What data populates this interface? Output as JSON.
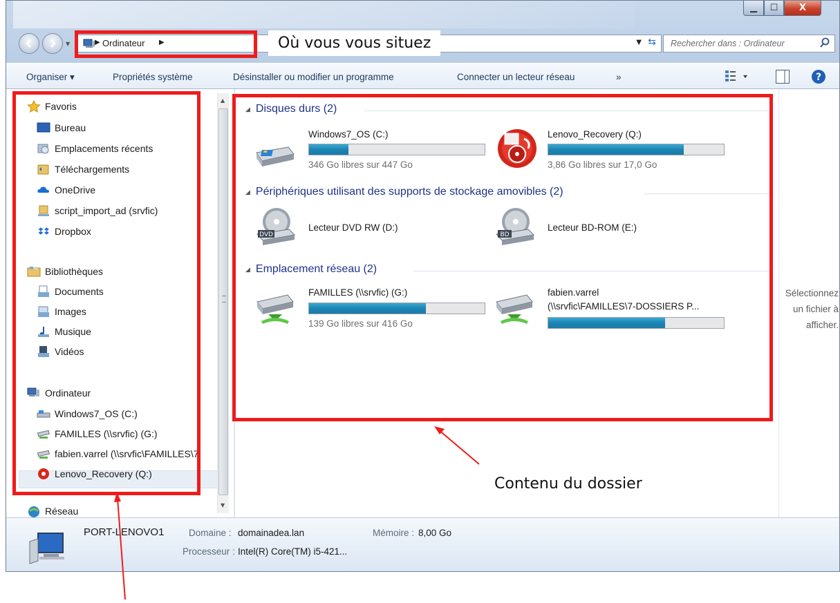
{
  "window": {
    "title_buttons": {
      "minimize": "▁",
      "maximize": "☐",
      "close": "X"
    }
  },
  "address_bar": {
    "breadcrumb": "Ordinateur",
    "search_placeholder": "Rechercher dans : Ordinateur"
  },
  "command_bar": {
    "organize": "Organiser",
    "system_properties": "Propriétés système",
    "uninstall": "Désinstaller ou modifier un programme",
    "map_drive": "Connecter un lecteur réseau",
    "more": "»"
  },
  "nav": {
    "favorites": [
      {
        "label": "Favoris",
        "icon": "star-icon"
      },
      {
        "label": "Bureau",
        "icon": "desktop-icon"
      },
      {
        "label": "Emplacements récents",
        "icon": "recent-places-icon"
      },
      {
        "label": "Téléchargements",
        "icon": "downloads-folder-icon"
      },
      {
        "label": "OneDrive",
        "icon": "cloud-icon"
      },
      {
        "label": "script_import_ad (srvfic)",
        "icon": "network-folder-icon"
      },
      {
        "label": "Dropbox",
        "icon": "dropbox-icon"
      }
    ],
    "libraries": [
      {
        "label": "Bibliothèques",
        "icon": "libraries-icon"
      },
      {
        "label": "Documents",
        "icon": "documents-icon"
      },
      {
        "label": "Images",
        "icon": "pictures-icon"
      },
      {
        "label": "Musique",
        "icon": "music-icon"
      },
      {
        "label": "Vidéos",
        "icon": "videos-icon"
      }
    ],
    "computer": [
      {
        "label": "Ordinateur",
        "icon": "computer-icon"
      },
      {
        "label": "Windows7_OS (C:)",
        "icon": "drive-icon"
      },
      {
        "label": "FAMILLES (\\\\srvfic) (G:)",
        "icon": "network-drive-icon"
      },
      {
        "label": "fabien.varrel (\\\\srvfic\\FAMILLES\\7",
        "icon": "network-drive-icon"
      },
      {
        "label": "Lenovo_Recovery (Q:)",
        "icon": "recovery-drive-icon"
      }
    ],
    "network": {
      "label": "Réseau",
      "icon": "network-icon"
    }
  },
  "content": {
    "groups": [
      {
        "title": "Disques durs (2)",
        "items": [
          {
            "name": "Windows7_OS (C:)",
            "free": "346 Go libres sur 447 Go",
            "used_fraction": 0.226
          },
          {
            "name": "Lenovo_Recovery (Q:)",
            "free": "3,86 Go libres sur 17,0 Go",
            "used_fraction": 0.773
          }
        ]
      },
      {
        "title": "Périphériques utilisant des supports de stockage amovibles (2)",
        "items": [
          {
            "name": "Lecteur DVD RW (D:)",
            "badge": "DVD"
          },
          {
            "name": "Lecteur BD-ROM (E:)",
            "badge": "BD"
          }
        ]
      },
      {
        "title": "Emplacement réseau (2)",
        "items": [
          {
            "name": "FAMILLES (\\\\srvfic) (G:)",
            "free": "139 Go libres sur 416 Go",
            "used_fraction": 0.666
          },
          {
            "name": "fabien.varrel",
            "name2": "(\\\\srvfic\\FAMILLES\\7-DOSSIERS P...",
            "used_fraction": 0.666
          }
        ]
      }
    ]
  },
  "preview": {
    "text": "Sélectionnez\nun fichier à\nafficher."
  },
  "details": {
    "computer_name": "PORT-LENOVO1",
    "domain_label": "Domaine :",
    "domain_value": "domainadea.lan",
    "memory_label": "Mémoire :",
    "memory_value": "8,00 Go",
    "cpu_label": "Processeur :",
    "cpu_value": "Intel(R) Core(TM) i5-421..."
  },
  "annotations": {
    "location_callout": "Où vous vous situez",
    "content_callout": "Contenu du dossier",
    "color": "#ee1c1c"
  }
}
